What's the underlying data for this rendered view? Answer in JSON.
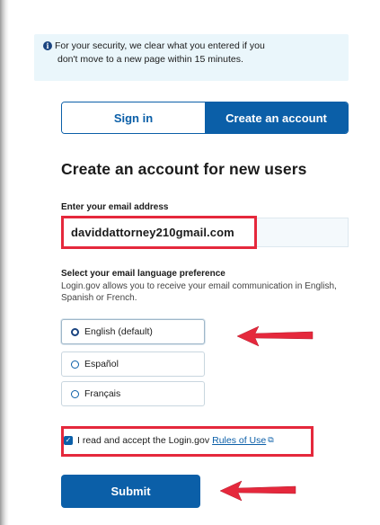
{
  "alert": {
    "line1": "For your security, we clear what you entered if you",
    "line2": "don't move to a new page within 15 minutes."
  },
  "tabs": [
    {
      "label": "Sign in",
      "active": false
    },
    {
      "label": "Create an account",
      "active": true
    }
  ],
  "heading": "Create an account for new users",
  "email": {
    "label": "Enter your email address",
    "value": "daviddattorney210gmail.com"
  },
  "language": {
    "label": "Select your email language preference",
    "help": "Login.gov allows you to receive your email communication in English, Spanish or French.",
    "options": [
      {
        "label": "English (default)",
        "selected": true
      },
      {
        "label": "Español",
        "selected": false
      },
      {
        "label": "Français",
        "selected": false
      }
    ]
  },
  "accept": {
    "text": "I read and accept the Login.gov",
    "link": "Rules of Use",
    "checked": true
  },
  "submit_label": "Submit",
  "colors": {
    "primary": "#0b5fa8",
    "highlight_red": "#e5283c",
    "alert_bg": "#eaf6fb"
  }
}
